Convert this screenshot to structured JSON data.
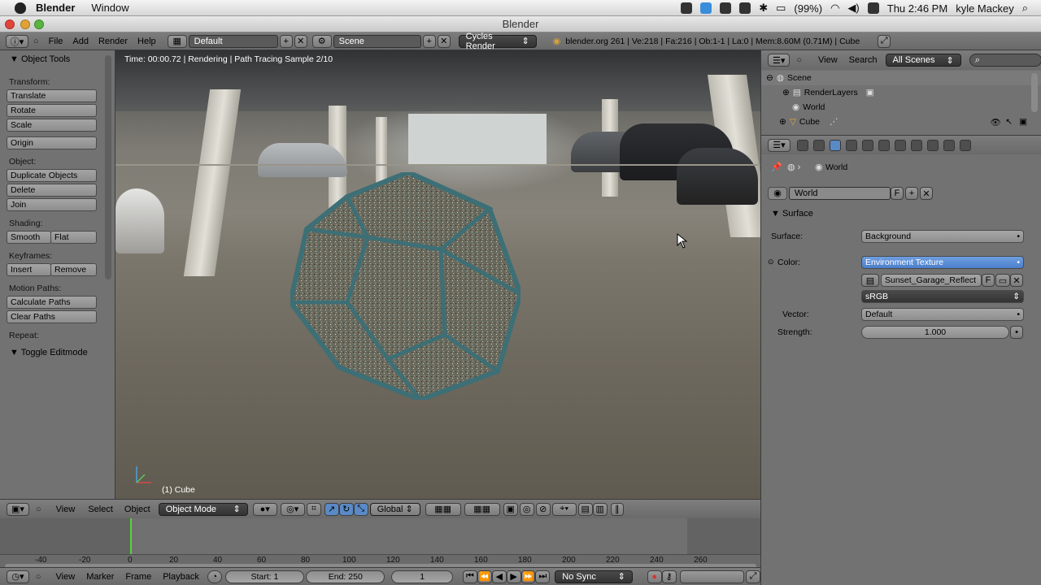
{
  "macbar": {
    "app": "Blender",
    "menus": [
      "Window"
    ],
    "battery": "(99%)",
    "clock": "Thu 2:46 PM",
    "user": "kyle Mackey"
  },
  "window": {
    "title": "Blender"
  },
  "info_header": {
    "menus": [
      "File",
      "Add",
      "Render",
      "Help"
    ],
    "screen_layout": "Default",
    "scene": "Scene",
    "render_engine": "Cycles Render",
    "stats": "blender.org 261 | Ve:218 | Fa:216 | Ob:1-1 | La:0 | Mem:8.60M (0.71M) | Cube"
  },
  "tool_shelf": {
    "panel_title": "Object Tools",
    "transform_label": "Transform:",
    "translate": "Translate",
    "rotate": "Rotate",
    "scale": "Scale",
    "origin": "Origin",
    "object_label": "Object:",
    "duplicate": "Duplicate Objects",
    "delete": "Delete",
    "join": "Join",
    "shading_label": "Shading:",
    "smooth": "Smooth",
    "flat": "Flat",
    "keyframes_label": "Keyframes:",
    "insert": "Insert",
    "remove": "Remove",
    "motion_label": "Motion Paths:",
    "calc_paths": "Calculate Paths",
    "clear_paths": "Clear Paths",
    "repeat_label": "Repeat:",
    "toggle_editmode": "Toggle Editmode"
  },
  "viewport": {
    "status": "Time: 00:00.72 | Rendering | Path Tracing Sample 2/10",
    "object_label": "(1) Cube"
  },
  "view3d_header": {
    "menus": [
      "View",
      "Select",
      "Object"
    ],
    "mode": "Object Mode",
    "orientation": "Global"
  },
  "timeline": {
    "ticks": [
      "-40",
      "-20",
      "0",
      "20",
      "40",
      "60",
      "80",
      "100",
      "120",
      "140",
      "160",
      "180",
      "200",
      "220",
      "240",
      "260"
    ],
    "current_frame_value": 0
  },
  "timeline_header": {
    "menus": [
      "View",
      "Marker",
      "Frame",
      "Playback"
    ],
    "start": "Start: 1",
    "end": "End: 250",
    "current": "1",
    "sync": "No Sync"
  },
  "outliner": {
    "menus": [
      "View",
      "Search"
    ],
    "filter": "All Scenes",
    "items": [
      "Scene",
      "RenderLayers",
      "World",
      "Cube"
    ]
  },
  "properties": {
    "breadcrumb": "World",
    "world_name": "World",
    "world_fake": "F",
    "surface_section": "Surface",
    "surface_label": "Surface:",
    "surface_value": "Background",
    "color_label": "Color:",
    "color_value": "Environment Texture",
    "image_name": "Sunset_Garage_Reflect",
    "image_fake": "F",
    "colorspace": "sRGB",
    "vector_label": "Vector:",
    "vector_value": "Default",
    "strength_label": "Strength:",
    "strength_value": "1.000"
  }
}
